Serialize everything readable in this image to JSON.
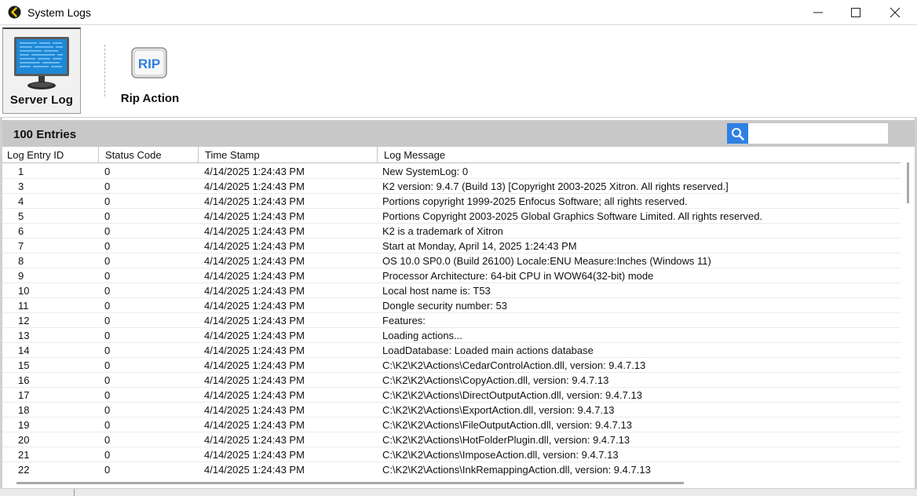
{
  "window": {
    "title": "System Logs",
    "icon": "k2-back-arrow-icon",
    "controls": [
      "minimize-icon",
      "maximize-icon",
      "close-icon"
    ]
  },
  "toolbar": {
    "server_log_label": "Server Log",
    "rip_action_label": "Rip Action",
    "rip_icon_text": "RIP"
  },
  "entries": {
    "count_label": "100 Entries",
    "search_placeholder": "",
    "search_value": ""
  },
  "grid": {
    "columns": [
      "Log Entry ID",
      "Status Code",
      "Time Stamp",
      "Log Message"
    ],
    "rows": [
      {
        "id": "1",
        "status": "0",
        "time": "4/14/2025 1:24:43 PM",
        "message": "New SystemLog: 0"
      },
      {
        "id": "3",
        "status": "0",
        "time": "4/14/2025 1:24:43 PM",
        "message": "K2 version: 9.4.7 (Build 13) [Copyright 2003-2025 Xitron. All rights reserved.]"
      },
      {
        "id": "4",
        "status": "0",
        "time": "4/14/2025 1:24:43 PM",
        "message": "Portions copyright 1999-2025 Enfocus Software; all rights reserved."
      },
      {
        "id": "5",
        "status": "0",
        "time": "4/14/2025 1:24:43 PM",
        "message": "Portions Copyright 2003-2025 Global Graphics Software Limited. All rights reserved."
      },
      {
        "id": "6",
        "status": "0",
        "time": "4/14/2025 1:24:43 PM",
        "message": "K2 is a trademark of Xitron"
      },
      {
        "id": "7",
        "status": "0",
        "time": "4/14/2025 1:24:43 PM",
        "message": "Start at Monday, April 14, 2025 1:24:43 PM"
      },
      {
        "id": "8",
        "status": "0",
        "time": "4/14/2025 1:24:43 PM",
        "message": "OS 10.0 SP0.0 (Build 26100)  Locale:ENU  Measure:Inches  (Windows 11)"
      },
      {
        "id": "9",
        "status": "0",
        "time": "4/14/2025 1:24:43 PM",
        "message": "Processor Architecture: 64-bit CPU in WOW64(32-bit) mode"
      },
      {
        "id": "10",
        "status": "0",
        "time": "4/14/2025 1:24:43 PM",
        "message": "Local host name is: T53"
      },
      {
        "id": "11",
        "status": "0",
        "time": "4/14/2025 1:24:43 PM",
        "message": "Dongle security number: 53"
      },
      {
        "id": "12",
        "status": "0",
        "time": "4/14/2025 1:24:43 PM",
        "message": "Features:"
      },
      {
        "id": "13",
        "status": "0",
        "time": "4/14/2025 1:24:43 PM",
        "message": "Loading actions..."
      },
      {
        "id": "14",
        "status": "0",
        "time": "4/14/2025 1:24:43 PM",
        "message": "LoadDatabase: Loaded main actions database"
      },
      {
        "id": "15",
        "status": "0",
        "time": "4/14/2025 1:24:43 PM",
        "message": "C:\\K2\\K2\\Actions\\CedarControlAction.dll, version: 9.4.7.13"
      },
      {
        "id": "16",
        "status": "0",
        "time": "4/14/2025 1:24:43 PM",
        "message": "C:\\K2\\K2\\Actions\\CopyAction.dll, version: 9.4.7.13"
      },
      {
        "id": "17",
        "status": "0",
        "time": "4/14/2025 1:24:43 PM",
        "message": "C:\\K2\\K2\\Actions\\DirectOutputAction.dll, version: 9.4.7.13"
      },
      {
        "id": "18",
        "status": "0",
        "time": "4/14/2025 1:24:43 PM",
        "message": "C:\\K2\\K2\\Actions\\ExportAction.dll, version: 9.4.7.13"
      },
      {
        "id": "19",
        "status": "0",
        "time": "4/14/2025 1:24:43 PM",
        "message": "C:\\K2\\K2\\Actions\\FileOutputAction.dll, version: 9.4.7.13"
      },
      {
        "id": "20",
        "status": "0",
        "time": "4/14/2025 1:24:43 PM",
        "message": "C:\\K2\\K2\\Actions\\HotFolderPlugin.dll, version: 9.4.7.13"
      },
      {
        "id": "21",
        "status": "0",
        "time": "4/14/2025 1:24:43 PM",
        "message": "C:\\K2\\K2\\Actions\\ImposeAction.dll, version: 9.4.7.13"
      },
      {
        "id": "22",
        "status": "0",
        "time": "4/14/2025 1:24:43 PM",
        "message": "C:\\K2\\K2\\Actions\\InkRemappingAction.dll, version: 9.4.7.13"
      }
    ]
  },
  "colors": {
    "search_button": "#2f80e4",
    "entries_bar": "#c8c8c8",
    "rip_icon_text": "#2f7fe0"
  }
}
